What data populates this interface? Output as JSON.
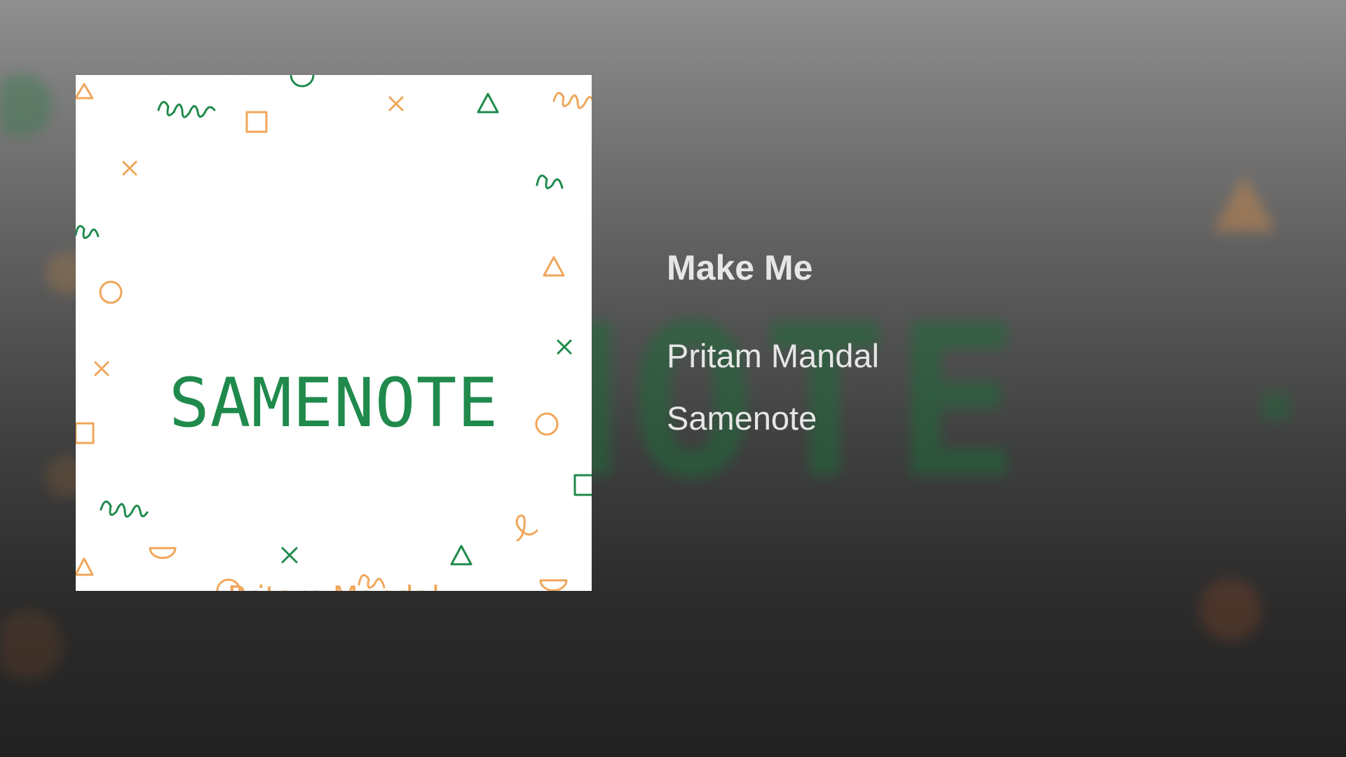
{
  "album_art": {
    "title_text": "SAMENOTE",
    "artist_text": "Pritam Mandal",
    "colors": {
      "green": "#1f8a4c",
      "orange": "#efa65a",
      "background": "#ffffff"
    }
  },
  "background": {
    "blurred_text": "ENOTE"
  },
  "track": {
    "title": "Make Me",
    "artist": "Pritam Mandal",
    "album": "Samenote"
  }
}
